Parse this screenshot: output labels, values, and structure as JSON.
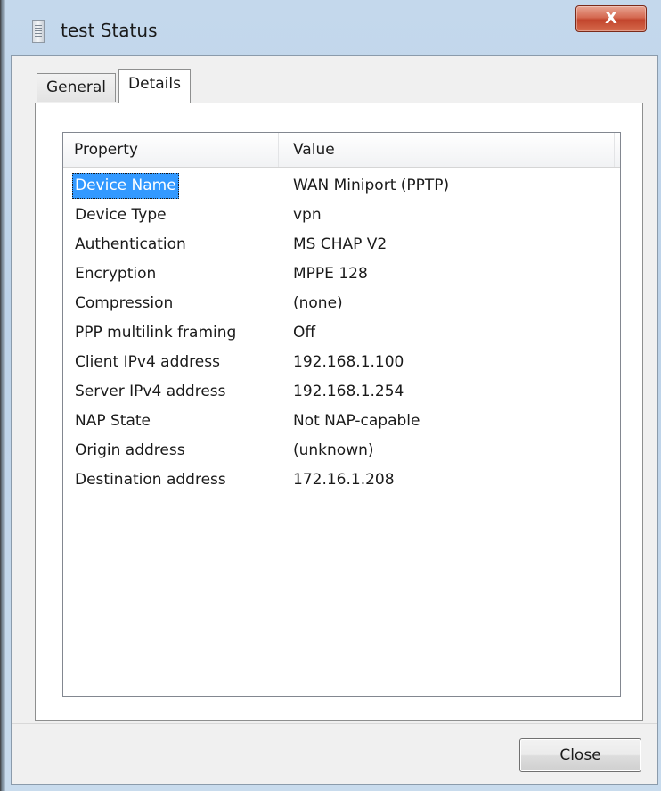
{
  "window": {
    "title": "test Status",
    "close_glyph": "X"
  },
  "tabs": [
    {
      "label": "General"
    },
    {
      "label": "Details"
    }
  ],
  "details": {
    "columns": {
      "property": "Property",
      "value": "Value"
    },
    "rows": [
      {
        "property": "Device Name",
        "value": "WAN Miniport (PPTP)"
      },
      {
        "property": "Device Type",
        "value": "vpn"
      },
      {
        "property": "Authentication",
        "value": "MS CHAP V2"
      },
      {
        "property": "Encryption",
        "value": "MPPE 128"
      },
      {
        "property": "Compression",
        "value": "(none)"
      },
      {
        "property": "PPP multilink framing",
        "value": "Off"
      },
      {
        "property": "Client IPv4 address",
        "value": "192.168.1.100"
      },
      {
        "property": "Server IPv4 address",
        "value": "192.168.1.254"
      },
      {
        "property": "NAP State",
        "value": "Not NAP-capable"
      },
      {
        "property": "Origin address",
        "value": "(unknown)"
      },
      {
        "property": "Destination address",
        "value": "172.16.1.208"
      }
    ],
    "selected_row": 0
  },
  "buttons": {
    "close": "Close"
  },
  "icons": {
    "app": "network-connection-icon",
    "close": "close-icon"
  },
  "colors": {
    "selection": "#3399ff",
    "close_button_red": "#c2452c"
  }
}
